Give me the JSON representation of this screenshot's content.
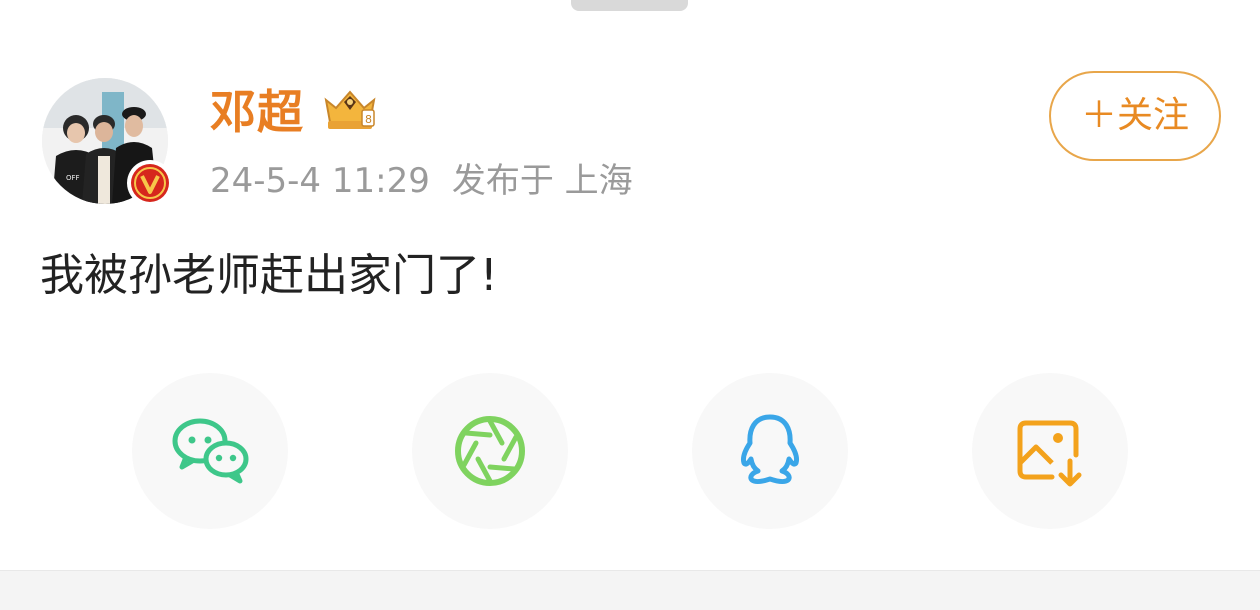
{
  "post": {
    "username": "邓超",
    "timestamp": "24-5-4 11:29",
    "location": "发布于 上海",
    "content": "我被孙老师赶出家门了!"
  },
  "follow_button": {
    "label": "＋关注"
  },
  "share_options": [
    {
      "icon": "wechat-icon",
      "color": "#3ec78a"
    },
    {
      "icon": "moments-icon",
      "color": "#7fd35f"
    },
    {
      "icon": "qq-icon",
      "color": "#3aa6e8"
    },
    {
      "icon": "save-image-icon",
      "color": "#f3a21c"
    }
  ],
  "colors": {
    "username": "#e87e23",
    "follow_border": "#e8a64a",
    "meta_text": "#9a9a9a",
    "verify_badge": "#d6261d"
  }
}
